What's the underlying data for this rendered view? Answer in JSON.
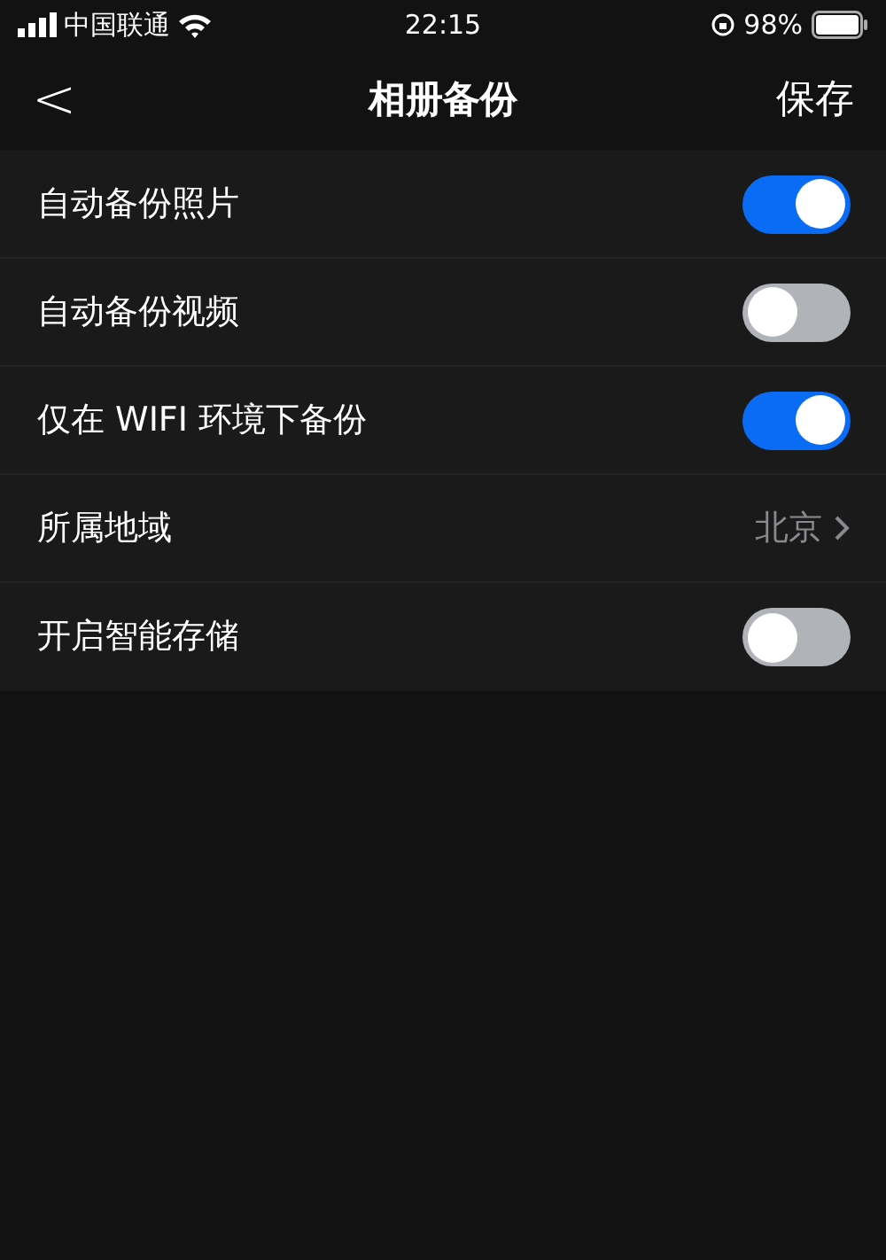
{
  "status_bar": {
    "carrier": "中国联通",
    "time": "22:15",
    "battery": "98%"
  },
  "nav": {
    "back": "<",
    "title": "相册备份",
    "action": "保存"
  },
  "settings": [
    {
      "kind": "toggle",
      "label": "自动备份照片",
      "on": true
    },
    {
      "kind": "toggle",
      "label": "自动备份视频",
      "on": false
    },
    {
      "kind": "toggle",
      "label": "仅在 WIFI 环境下备份",
      "on": true
    },
    {
      "kind": "link",
      "label": "所属地域",
      "value": "北京"
    },
    {
      "kind": "toggle",
      "label": "开启智能存储",
      "on": false
    }
  ]
}
